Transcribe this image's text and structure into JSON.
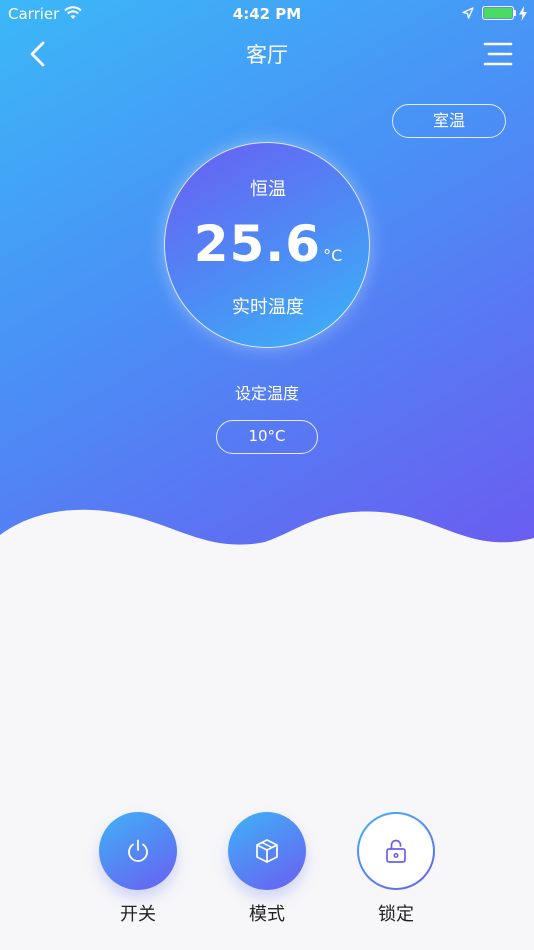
{
  "status_bar": {
    "carrier": "Carrier",
    "time": "4:42 PM",
    "battery_color": "#4cd964",
    "icons": [
      "wifi-icon",
      "location-arrow-icon",
      "battery-icon",
      "charging-bolt-icon"
    ]
  },
  "nav": {
    "title": "客厅",
    "back_icon": "chevron-left-icon",
    "menu_icon": "menu-icon"
  },
  "room_temp_button": "室温",
  "dial": {
    "mode": "恒温",
    "value": "25.6",
    "unit": "°C",
    "caption": "实时温度"
  },
  "setpoint": {
    "label": "设定温度",
    "value": "10°C"
  },
  "controls": [
    {
      "label": "开关",
      "icon": "power-icon"
    },
    {
      "label": "模式",
      "icon": "cube-icon"
    },
    {
      "label": "锁定",
      "icon": "unlock-icon"
    }
  ],
  "colors": {
    "gradient_start": "#3bb8f7",
    "gradient_end": "#6b5bf0",
    "background": "#f7f7f9"
  }
}
